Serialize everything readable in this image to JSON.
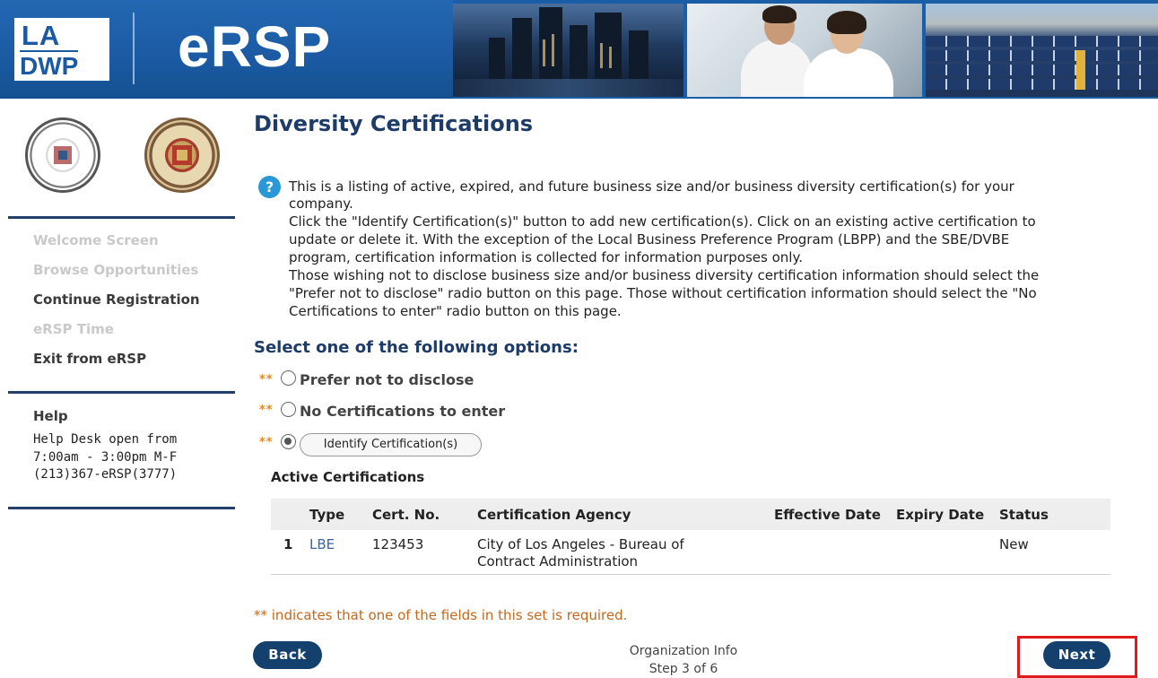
{
  "header": {
    "logo_line1": "LA",
    "logo_line2": "DWP",
    "app_name": "eRSP"
  },
  "sidebar": {
    "nav": [
      {
        "label": "Welcome Screen",
        "enabled": false
      },
      {
        "label": "Browse Opportunities",
        "enabled": false
      },
      {
        "label": "Continue Registration",
        "enabled": true
      },
      {
        "label": "eRSP Time",
        "enabled": false
      },
      {
        "label": "Exit from eRSP",
        "enabled": true
      }
    ],
    "help": {
      "title": "Help",
      "lines": [
        "Help Desk open from",
        "7:00am - 3:00pm M-F",
        "(213)367-eRSP(3777)"
      ]
    }
  },
  "main": {
    "title": "Diversity Certifications",
    "info_icon": "?",
    "info_lines": [
      "This is a listing of active, expired, and future business size and/or business diversity certification(s) for your",
      "company.",
      "Click the \"Identify Certification(s)\" button to add new certification(s). Click on an existing active certification to",
      "update or delete it. With the exception of the Local Business Preference Program (LBPP) and the SBE/DVBE",
      "program, certification information is collected for information purposes only.",
      "Those wishing not to disclose business size and/or business diversity certification information should select the",
      "\"Prefer not to disclose\" radio button on this page. Those without certification information should select the \"No",
      "Certifications to enter\" radio button on this page."
    ],
    "options_title": "Select one of the following options:",
    "required_marker": "**",
    "options": [
      {
        "label": "Prefer not to disclose",
        "selected": false
      },
      {
        "label": "No Certifications to enter",
        "selected": false
      },
      {
        "label": "Identify Certification(s)",
        "selected": true
      }
    ],
    "table": {
      "title": "Active Certifications",
      "headers": [
        "Type",
        "Cert. No.",
        "Certification Agency",
        "Effective Date",
        "Expiry Date",
        "Status"
      ],
      "rows": [
        {
          "index": "1",
          "type": "LBE",
          "cert_no": "123453",
          "agency_line1": "City of Los Angeles - Bureau of",
          "agency_line2": "Contract Administration",
          "effective_date": "",
          "expiry_date": "",
          "status": "New"
        }
      ]
    },
    "footnote": "** indicates that one of the fields in this set is required."
  },
  "footer": {
    "back_label": "Back",
    "next_label": "Next",
    "step_line1": "Organization Info",
    "step_line2": "Step 3 of 6"
  },
  "colors": {
    "brand_navy": "#14406e",
    "title_blue": "#1e3c68",
    "required_orange": "#e58a2a",
    "highlight_red": "#e01b1b",
    "info_blue": "#2a97d6"
  }
}
